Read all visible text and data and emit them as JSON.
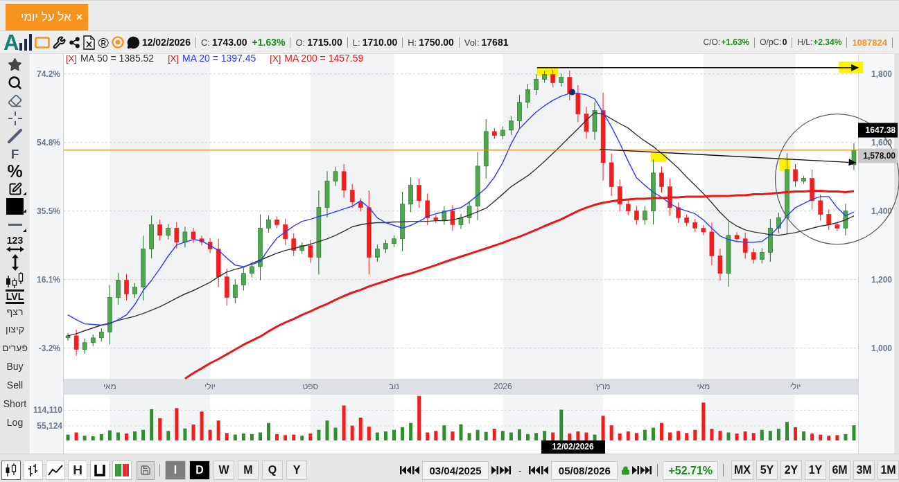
{
  "tabs": [
    {
      "label": "אל על יומי",
      "close": "×",
      "selected": true
    }
  ],
  "info_bar": {
    "logo": "A",
    "registered_mark": "®",
    "date": "12/02/2026",
    "stats": [
      {
        "label": "C:",
        "value": "1743.00",
        "change": "+1.63%"
      },
      {
        "label": "O:",
        "value": "1715.00"
      },
      {
        "label": "L:",
        "value": "1710.00"
      },
      {
        "label": "H:",
        "value": "1750.00"
      },
      {
        "label": "Vol:",
        "value": "17681"
      }
    ],
    "ratios": [
      {
        "label": "C/O:",
        "value": "+1.63%",
        "kind": "gain"
      },
      {
        "label": "O/pC:",
        "value": "0",
        "kind": "flat"
      },
      {
        "label": "H/L:",
        "value": "+2.34%",
        "kind": "gain"
      }
    ],
    "count": "1087824"
  },
  "toolbar": {
    "upper_tools": [
      "F",
      "%"
    ],
    "digits_tool": "123",
    "level_tool": "LVL",
    "lower_tools": [
      "רצף",
      "קיצון",
      "פערים",
      "Buy",
      "Sell",
      "Short",
      "Log"
    ]
  },
  "price_chart": {
    "remove_marks": [
      "[X]",
      "[X]",
      "[X]"
    ],
    "left_axis_ticks": [
      "74.2%",
      "54.8%",
      "35.5%",
      "16.1%",
      "-3.2%"
    ],
    "price_tags": [
      {
        "text": "1647.38",
        "kind": "last"
      },
      {
        "text": "1,578.00",
        "kind": "level"
      }
    ],
    "chart_data": {
      "type": "candlestick",
      "grid": true,
      "categories": [
        null,
        null,
        null,
        null,
        null,
        "מאי",
        null,
        null,
        null,
        null,
        null,
        null,
        null,
        null,
        null,
        null,
        null,
        "יולי",
        null,
        null,
        null,
        null,
        null,
        null,
        null,
        null,
        null,
        null,
        null,
        "ספט",
        null,
        null,
        null,
        null,
        null,
        null,
        null,
        null,
        null,
        "נוב",
        null,
        null,
        null,
        null,
        null,
        null,
        null,
        null,
        null,
        null,
        null,
        null,
        "2026",
        null,
        null,
        null,
        null,
        null,
        null,
        null,
        null,
        null,
        null,
        null,
        "מרץ",
        null,
        null,
        null,
        null,
        null,
        null,
        null,
        null,
        null,
        null,
        null,
        "מאי",
        null,
        null,
        null,
        null,
        null,
        null,
        null,
        null,
        null,
        null,
        "יולי",
        null,
        null,
        null,
        null,
        null,
        null,
        null
      ],
      "ohlc": [
        [
          1030,
          1044,
          1022,
          1036
        ],
        [
          1036,
          1054,
          978,
          996
        ],
        [
          996,
          1028,
          984,
          1016
        ],
        [
          1016,
          1040,
          1006,
          1030
        ],
        [
          1030,
          1058,
          1019,
          1047
        ],
        [
          1047,
          1184,
          1011,
          1148
        ],
        [
          1148,
          1219,
          1127,
          1198
        ],
        [
          1198,
          1216,
          1140,
          1158
        ],
        [
          1158,
          1190,
          1146,
          1178
        ],
        [
          1178,
          1328,
          1139,
          1289
        ],
        [
          1289,
          1387,
          1262,
          1360
        ],
        [
          1360,
          1375,
          1314,
          1329
        ],
        [
          1329,
          1362,
          1317,
          1350
        ],
        [
          1350,
          1368,
          1291,
          1309
        ],
        [
          1309,
          1354,
          1294,
          1339
        ],
        [
          1339,
          1351,
          1307,
          1319
        ],
        [
          1319,
          1328,
          1300,
          1309
        ],
        [
          1309,
          1321,
          1277,
          1289
        ],
        [
          1289,
          1319,
          1178,
          1208
        ],
        [
          1208,
          1232,
          1124,
          1148
        ],
        [
          1148,
          1201,
          1131,
          1184
        ],
        [
          1184,
          1234,
          1168,
          1218
        ],
        [
          1218,
          1250,
          1206,
          1238
        ],
        [
          1238,
          1390,
          1198,
          1350
        ],
        [
          1350,
          1387,
          1337,
          1374
        ],
        [
          1374,
          1384,
          1350,
          1360
        ],
        [
          1360,
          1378,
          1301,
          1319
        ],
        [
          1319,
          1335,
          1269,
          1285
        ],
        [
          1285,
          1309,
          1275,
          1299
        ],
        [
          1299,
          1315,
          1249,
          1265
        ],
        [
          1265,
          1460,
          1215,
          1410
        ],
        [
          1410,
          1516,
          1381,
          1487
        ],
        [
          1487,
          1529,
          1473,
          1515
        ],
        [
          1515,
          1537,
          1439,
          1461
        ],
        [
          1461,
          1478,
          1409,
          1426
        ],
        [
          1426,
          1437,
          1399,
          1410
        ],
        [
          1410,
          1460,
          1215,
          1265
        ],
        [
          1265,
          1302,
          1252,
          1289
        ],
        [
          1289,
          1316,
          1278,
          1305
        ],
        [
          1305,
          1329,
          1295,
          1319
        ],
        [
          1319,
          1456,
          1283,
          1420
        ],
        [
          1420,
          1498,
          1397,
          1475
        ],
        [
          1475,
          1495,
          1410,
          1430
        ],
        [
          1430,
          1451,
          1359,
          1380
        ],
        [
          1380,
          1388,
          1366,
          1374
        ],
        [
          1374,
          1414,
          1360,
          1400
        ],
        [
          1400,
          1418,
          1342,
          1360
        ],
        [
          1360,
          1392,
          1348,
          1380
        ],
        [
          1380,
          1430,
          1364,
          1414
        ],
        [
          1414,
          1572,
          1373,
          1531
        ],
        [
          1531,
          1668,
          1495,
          1632
        ],
        [
          1632,
          1642,
          1610,
          1620
        ],
        [
          1620,
          1647,
          1609,
          1636
        ],
        [
          1636,
          1677,
          1622,
          1663
        ],
        [
          1663,
          1739,
          1641,
          1717
        ],
        [
          1717,
          1771,
          1700,
          1754
        ],
        [
          1754,
          1799,
          1739,
          1784
        ],
        [
          1784,
          1808,
          1774,
          1798
        ],
        [
          1798,
          1811,
          1761,
          1774
        ],
        [
          1774,
          1801,
          1763,
          1790
        ],
        [
          1790,
          1810,
          1723,
          1743
        ],
        [
          1743,
          1767,
          1659,
          1683
        ],
        [
          1683,
          1704,
          1611,
          1632
        ],
        [
          1632,
          1717,
          1608,
          1693
        ],
        [
          1693,
          1745,
          1489,
          1541
        ],
        [
          1541,
          1568,
          1444,
          1471
        ],
        [
          1471,
          1492,
          1399,
          1420
        ],
        [
          1420,
          1432,
          1388,
          1400
        ],
        [
          1400,
          1414,
          1360,
          1374
        ],
        [
          1374,
          1414,
          1360,
          1400
        ],
        [
          1400,
          1550,
          1361,
          1511
        ],
        [
          1511,
          1529,
          1453,
          1471
        ],
        [
          1471,
          1495,
          1386,
          1410
        ],
        [
          1410,
          1425,
          1365,
          1380
        ],
        [
          1380,
          1390,
          1356,
          1366
        ],
        [
          1366,
          1377,
          1339,
          1350
        ],
        [
          1350,
          1359,
          1330,
          1339
        ],
        [
          1339,
          1366,
          1242,
          1269
        ],
        [
          1269,
          1290,
          1197,
          1218
        ],
        [
          1218,
          1368,
          1179,
          1329
        ],
        [
          1329,
          1338,
          1310,
          1319
        ],
        [
          1319,
          1337,
          1261,
          1279
        ],
        [
          1279,
          1291,
          1247,
          1259
        ],
        [
          1259,
          1291,
          1247,
          1279
        ],
        [
          1279,
          1377,
          1252,
          1350
        ],
        [
          1350,
          1395,
          1335,
          1380
        ],
        [
          1380,
          1569,
          1332,
          1521
        ],
        [
          1521,
          1537,
          1471,
          1487
        ],
        [
          1487,
          1503,
          1479,
          1495
        ],
        [
          1495,
          1521,
          1404,
          1430
        ],
        [
          1430,
          1448,
          1372,
          1390
        ],
        [
          1390,
          1405,
          1345,
          1360
        ],
        [
          1360,
          1369,
          1341,
          1350
        ],
        [
          1350,
          1421,
          1329,
          1400
        ],
        [
          1535,
          1598,
          1520,
          1578
        ]
      ],
      "series": [
        {
          "type": "line",
          "name": "MA 50 = 1385.52",
          "color": "#333333",
          "values": [
            1036,
            1042,
            1051,
            1059,
            1067,
            1073,
            1081,
            1087,
            1093,
            1101,
            1111,
            1121,
            1133,
            1146,
            1158,
            1168,
            1180,
            1192,
            1208,
            1222,
            1230,
            1236,
            1247,
            1257,
            1267,
            1277,
            1285,
            1291,
            1297,
            1303,
            1311,
            1319,
            1329,
            1341,
            1354,
            1360,
            1364,
            1366,
            1366,
            1368,
            1368,
            1370,
            1370,
            1370,
            1372,
            1372,
            1374,
            1380,
            1388,
            1398,
            1408,
            1428,
            1449,
            1471,
            1487,
            1503,
            1523,
            1545,
            1568,
            1592,
            1616,
            1640,
            1665,
            1687,
            1683,
            1669,
            1655,
            1642,
            1622,
            1604,
            1588,
            1568,
            1547,
            1525,
            1499,
            1475,
            1451,
            1424,
            1396,
            1372,
            1356,
            1345,
            1339,
            1335,
            1331,
            1329,
            1333,
            1337,
            1343,
            1350,
            1356,
            1360,
            1366,
            1374,
            1386
          ]
        },
        {
          "type": "line",
          "name": "MA 20 = 1397.45",
          "color": "#2b3cff",
          "values": [
            1097,
            1083,
            1071,
            1069,
            1067,
            1071,
            1083,
            1097,
            1127,
            1168,
            1198,
            1232,
            1269,
            1301,
            1309,
            1317,
            1313,
            1299,
            1285,
            1263,
            1242,
            1238,
            1244,
            1253,
            1289,
            1321,
            1339,
            1356,
            1370,
            1376,
            1384,
            1390,
            1398,
            1406,
            1414,
            1430,
            1410,
            1380,
            1366,
            1358,
            1350,
            1358,
            1370,
            1384,
            1392,
            1398,
            1404,
            1410,
            1426,
            1446,
            1467,
            1499,
            1541,
            1596,
            1640,
            1665,
            1689,
            1707,
            1723,
            1735,
            1743,
            1743,
            1739,
            1727,
            1687,
            1646,
            1598,
            1545,
            1497,
            1475,
            1455,
            1440,
            1422,
            1408,
            1400,
            1392,
            1374,
            1350,
            1327,
            1317,
            1311,
            1309,
            1309,
            1311,
            1329,
            1354,
            1386,
            1410,
            1422,
            1434,
            1442,
            1442,
            1410,
            1386,
            1397
          ]
        },
        {
          "type": "line",
          "name": "MA 200 = 1457.59",
          "color": "#e81818",
          "values": [
            null,
            null,
            null,
            null,
            null,
            null,
            null,
            null,
            null,
            null,
            null,
            null,
            null,
            null,
            911,
            927,
            941,
            956,
            968,
            982,
            996,
            1010,
            1022,
            1034,
            1049,
            1063,
            1075,
            1085,
            1097,
            1107,
            1119,
            1129,
            1141,
            1152,
            1162,
            1170,
            1180,
            1188,
            1196,
            1204,
            1212,
            1218,
            1226,
            1234,
            1242,
            1251,
            1259,
            1267,
            1275,
            1283,
            1291,
            1299,
            1307,
            1317,
            1325,
            1335,
            1345,
            1356,
            1366,
            1376,
            1388,
            1400,
            1410,
            1418,
            1424,
            1428,
            1432,
            1434,
            1436,
            1436,
            1438,
            1438,
            1440,
            1440,
            1442,
            1442,
            1442,
            1444,
            1444,
            1444,
            1446,
            1446,
            1449,
            1449,
            1451,
            1453,
            1455,
            1457,
            1457,
            1459,
            1459,
            1457,
            1457,
            1455,
            1458
          ]
        }
      ],
      "ref_lines": [
        {
          "axis": "y",
          "value": 1578,
          "color": "#e8862a"
        }
      ],
      "ylim": [
        910.5,
        1858
      ],
      "yticks": [
        {
          "value": 1800,
          "label": "1,800"
        },
        {
          "value": 1600,
          "label": "1,600"
        },
        {
          "value": 1400,
          "label": "1,400"
        },
        {
          "value": 1200,
          "label": "1,200"
        },
        {
          "value": 1000,
          "label": "1,000"
        }
      ]
    }
  },
  "volume_chart": {
    "cursor_date": "12/02/2026",
    "chart_data": {
      "type": "bar",
      "grid": true,
      "categories": [
        null,
        null,
        null,
        null,
        null,
        null,
        null,
        null,
        null,
        null,
        null,
        null,
        null,
        null,
        null,
        null,
        null,
        null,
        null,
        null,
        null,
        null,
        null,
        null,
        null,
        null,
        null,
        null,
        null,
        null,
        null,
        null,
        null,
        null,
        null,
        null,
        null,
        null,
        null,
        null,
        null,
        null,
        null,
        null,
        null,
        null,
        null,
        null,
        null,
        null,
        null,
        null,
        null,
        null,
        null,
        null,
        null,
        null,
        null,
        null,
        null,
        null,
        null,
        null,
        null,
        null,
        null,
        null,
        null,
        null,
        null,
        null,
        null,
        null,
        null,
        null,
        null,
        null,
        null,
        null,
        null,
        null,
        null,
        null,
        null,
        null,
        null,
        null,
        null,
        null,
        null,
        null,
        null,
        null,
        null
      ],
      "series": [
        {
          "values": [
            22000,
            30000,
            18000,
            16000,
            24000,
            38000,
            30000,
            26000,
            34000,
            40000,
            118000,
            84000,
            36000,
            122000,
            45000,
            60000,
            109000,
            40000,
            75000,
            28000,
            22000,
            26000,
            24000,
            30000,
            66000,
            24000,
            20000,
            22000,
            18000,
            26000,
            40000,
            75000,
            48000,
            132000,
            56000,
            86000,
            52000,
            30000,
            34000,
            40000,
            50000,
            66000,
            168000,
            30000,
            36000,
            57000,
            34000,
            61000,
            28000,
            40000,
            32000,
            44000,
            36000,
            30000,
            42000,
            24000,
            28000,
            36000,
            30000,
            116000,
            26000,
            34000,
            30000,
            22000,
            93000,
            57000,
            26000,
            34000,
            28000,
            40000,
            48000,
            66000,
            30000,
            36000,
            28000,
            40000,
            143000,
            44000,
            36000,
            30000,
            26000,
            34000,
            28000,
            40000,
            36000,
            44000,
            70000,
            50000,
            34000,
            26000,
            22000,
            18000,
            20000,
            24000,
            57000
          ]
        }
      ],
      "ylim": [
        0,
        172400
      ],
      "yticks": [
        {
          "value": 114110,
          "label": "114,110"
        },
        {
          "value": 55124,
          "label": "55,124"
        }
      ]
    }
  },
  "bottom_bar": {
    "chart_types": [
      {
        "kind": "candles",
        "selected": true
      },
      {
        "kind": "ohlc",
        "selected": false
      },
      {
        "kind": "line",
        "selected": false
      },
      {
        "kind": "letter",
        "label": "H",
        "selected": false
      },
      {
        "kind": "bracket",
        "selected": false
      },
      {
        "kind": "colors",
        "selected": false
      }
    ],
    "periods": [
      {
        "label": "I",
        "selected": false,
        "disabled": true
      },
      {
        "label": "D",
        "selected": true,
        "disabled": false
      },
      {
        "label": "W",
        "selected": false,
        "disabled": false
      },
      {
        "label": "M",
        "selected": false,
        "disabled": false
      },
      {
        "label": "Q",
        "selected": false,
        "disabled": false
      },
      {
        "label": "Y",
        "selected": false,
        "disabled": false
      }
    ],
    "from_date": "03/04/2025",
    "range_separator": "-",
    "to_date": "05/08/2026",
    "locked": true,
    "change": "+52.71%",
    "ranges": [
      {
        "label": "MX",
        "selected": false
      },
      {
        "label": "5Y",
        "selected": false
      },
      {
        "label": "2Y",
        "selected": false
      },
      {
        "label": "1Y",
        "selected": false
      },
      {
        "label": "6M",
        "selected": false
      },
      {
        "label": "3M",
        "selected": false
      },
      {
        "label": "1M",
        "selected": false
      }
    ]
  }
}
